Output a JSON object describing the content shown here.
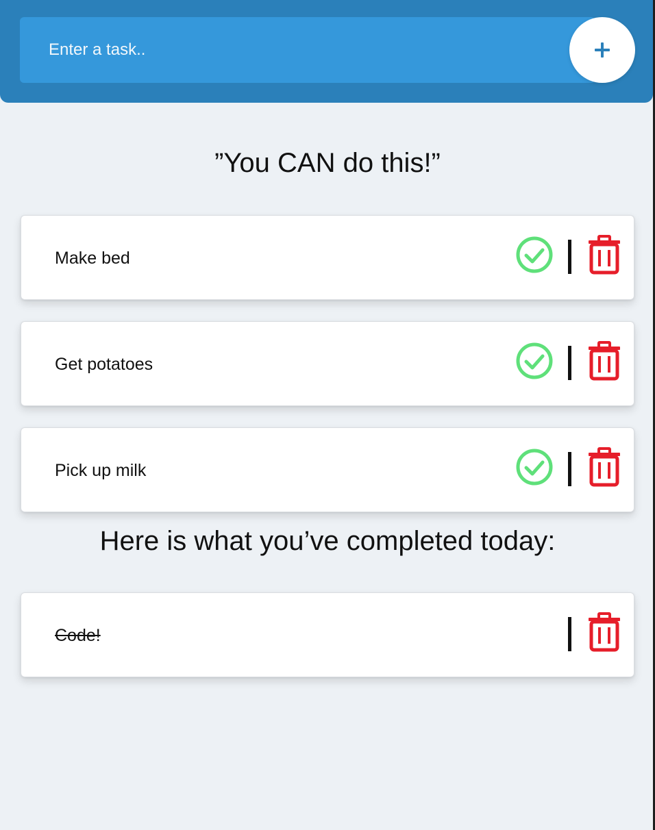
{
  "input": {
    "placeholder": "Enter a task.."
  },
  "add_button": {
    "label": "+"
  },
  "quote": "”You CAN do this!”",
  "todo_tasks": [
    {
      "text": "Make bed"
    },
    {
      "text": "Get potatoes"
    },
    {
      "text": "Pick up milk"
    }
  ],
  "completed_heading": "Here is what you’ve completed today:",
  "completed_tasks": [
    {
      "text": "Code!"
    }
  ],
  "icons": {
    "add": "plus-icon",
    "complete": "check-circle-icon",
    "delete": "trash-icon"
  },
  "colors": {
    "header": "#2b80ba",
    "input": "#3598db",
    "check": "#5fe07a",
    "trash": "#e61e2a",
    "background": "#edf1f5"
  }
}
